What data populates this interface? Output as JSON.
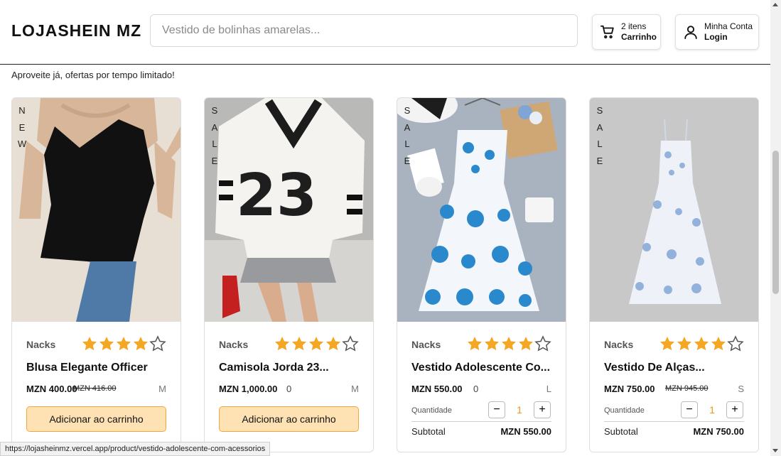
{
  "header": {
    "logo": "LOJASHEIN MZ",
    "search_placeholder": "Vestido de bolinhas amarelas...",
    "cart": {
      "count_label": "2 itens",
      "label": "Carrinho"
    },
    "account": {
      "label": "Minha Conta",
      "sub_label": "Login"
    }
  },
  "promo_text": "Aproveite já, ofertas por tempo limitado!",
  "colors": {
    "star": "#f5a623",
    "accent_button": "#ffe2b4",
    "accent_border": "#f3a63a",
    "quantity": "#e59b1e"
  },
  "products": [
    {
      "badge": [
        "N",
        "E",
        "W"
      ],
      "brand": "Nacks",
      "rating": 4,
      "max_rating": 5,
      "name": "Blusa Elegante Officer",
      "price": "MZN 400.00",
      "old_price": "MZN 416.00",
      "size": "M",
      "button": "Adicionar ao carrinho"
    },
    {
      "badge": [
        "S",
        "A",
        "L",
        "E"
      ],
      "brand": "Nacks",
      "rating": 4,
      "max_rating": 5,
      "name": "Camisola Jorda 23...",
      "price": "MZN 1,000.00",
      "extra": "0",
      "size": "M",
      "button": "Adicionar ao carrinho"
    },
    {
      "badge": [
        "S",
        "A",
        "L",
        "E"
      ],
      "brand": "Nacks",
      "rating": 4,
      "max_rating": 5,
      "name": "Vestido Adolescente Co...",
      "price": "MZN 550.00",
      "extra": "0",
      "size": "L",
      "quantity_label": "Quantidade",
      "quantity": "1",
      "subtotal_label": "Subtotal",
      "subtotal": "MZN 550.00"
    },
    {
      "badge": [
        "S",
        "A",
        "L",
        "E"
      ],
      "brand": "Nacks",
      "rating": 4,
      "max_rating": 5,
      "name": "Vestido De Alças...",
      "price": "MZN 750.00",
      "old_price": "MZN 945.00",
      "size": "S",
      "quantity_label": "Quantidade",
      "quantity": "1",
      "subtotal_label": "Subtotal",
      "subtotal": "MZN 750.00"
    }
  ],
  "status_url": "https://lojasheinmz.vercel.app/product/vestido-adolescente-com-acessorios"
}
